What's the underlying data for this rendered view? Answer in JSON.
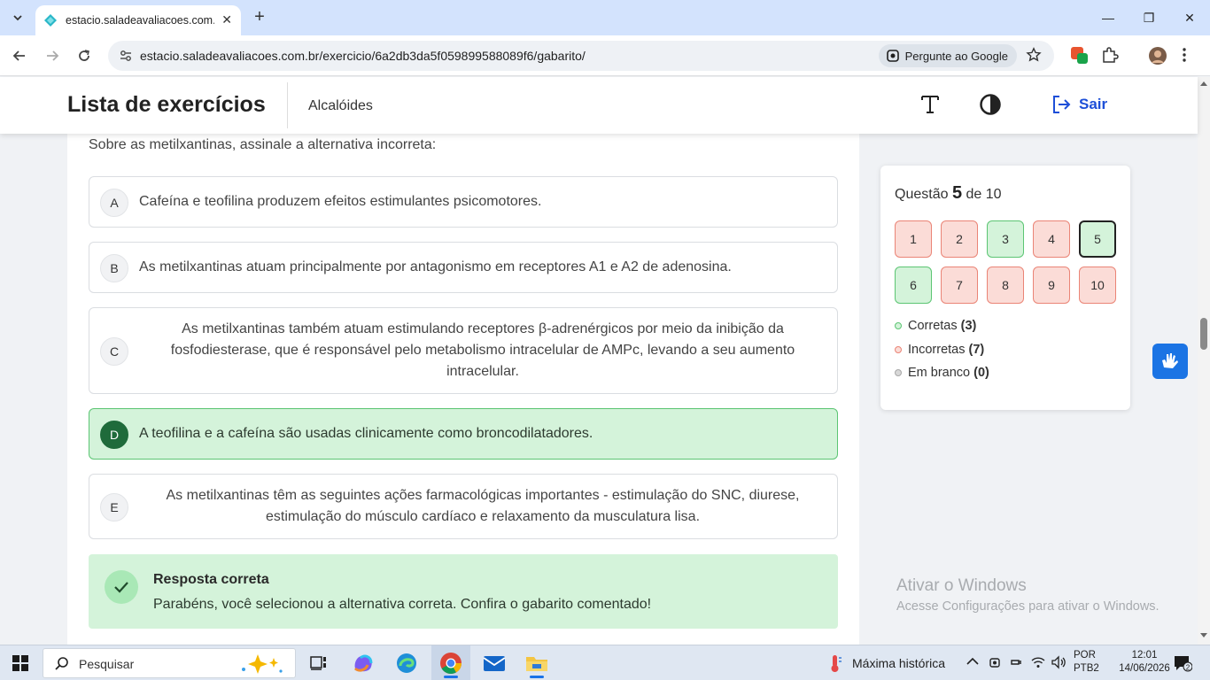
{
  "browser": {
    "tab_title": "estacio.saladeavaliacoes.com.br",
    "url": "estacio.saladeavaliacoes.com.br/exercicio/6a2db3da5f059899588089f6/gabarito/",
    "google_pill": "Pergunte ao Google"
  },
  "header": {
    "title": "Lista de exercícios",
    "subject": "Alcalóides",
    "logout_label": "Sair",
    "accent_color": "#1d4fd8"
  },
  "question": {
    "prompt": "Sobre as metilxantinas, assinale a alternativa incorreta:",
    "options": [
      {
        "letter": "A",
        "text": "Cafeína e teofilina produzem efeitos estimulantes psicomotores."
      },
      {
        "letter": "B",
        "text": "As metilxantinas atuam principalmente por antagonismo em receptores A1 e A2 de adenosina."
      },
      {
        "letter": "C",
        "text": "As metilxantinas também atuam estimulando receptores β-adrenérgicos por meio da inibição da fosfodiesterase, que é responsável pelo metabolismo intracelular de AMPc, levando a seu aumento intracelular."
      },
      {
        "letter": "D",
        "text": "A teofilina e a cafeína são usadas clinicamente como broncodilatadores.",
        "selected": true
      },
      {
        "letter": "E",
        "text": "As metilxantinas têm as seguintes ações farmacológicas importantes - estimulação do SNC, diurese, estimulação do músculo cardíaco e relaxamento da musculatura lisa."
      }
    ]
  },
  "feedback": {
    "title": "Resposta correta",
    "message": "Parabéns, você selecionou a alternativa correta. Confira o gabarito comentado!"
  },
  "progress": {
    "label_prefix": "Questão",
    "current": "5",
    "label_suffix": "de 10",
    "questions": [
      {
        "n": "1",
        "status": "wrong"
      },
      {
        "n": "2",
        "status": "wrong"
      },
      {
        "n": "3",
        "status": "right"
      },
      {
        "n": "4",
        "status": "wrong"
      },
      {
        "n": "5",
        "status": "right",
        "current": true
      },
      {
        "n": "6",
        "status": "right"
      },
      {
        "n": "7",
        "status": "wrong"
      },
      {
        "n": "8",
        "status": "wrong"
      },
      {
        "n": "9",
        "status": "wrong"
      },
      {
        "n": "10",
        "status": "wrong"
      }
    ],
    "legend": [
      {
        "label": "Corretas",
        "count": "(3)",
        "color": "#5cc573"
      },
      {
        "label": "Incorretas",
        "count": "(7)",
        "color": "#ea8476"
      },
      {
        "label": "Em branco",
        "count": "(0)",
        "color": "#b0b0b0"
      }
    ]
  },
  "watermark": {
    "line1": "Ativar o Windows",
    "line2": "Acesse Configurações para ativar o Windows."
  },
  "taskbar": {
    "search_label": "Pesquisar",
    "weather": "Máxima histórica",
    "lang1": "POR",
    "lang2": "PTB2",
    "time": "12:01",
    "date": "14/06/2026",
    "notifications": "2"
  }
}
